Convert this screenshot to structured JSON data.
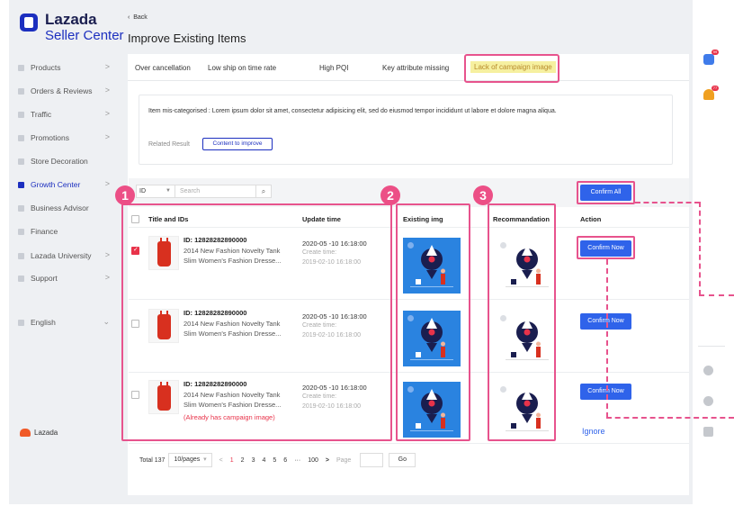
{
  "app": {
    "brand": "Lazada",
    "brand_sub": "Seller Center",
    "footer_brand": "Lazada"
  },
  "header": {
    "back_label": "Back",
    "title": "Improve Existing Items"
  },
  "sidebar": {
    "items": [
      {
        "label": "Products",
        "icon": "box-icon",
        "arrow": ">"
      },
      {
        "label": "Orders & Reviews",
        "icon": "orders-icon",
        "arrow": ">"
      },
      {
        "label": "Traffic",
        "icon": "traffic-icon",
        "arrow": ">"
      },
      {
        "label": "Promotions",
        "icon": "promotions-icon",
        "arrow": ">"
      },
      {
        "label": "Store Decoration",
        "icon": "store-icon",
        "arrow": ""
      },
      {
        "label": "Growth Center",
        "icon": "growth-icon",
        "arrow": ">"
      },
      {
        "label": "Business Advisor",
        "icon": "advisor-icon",
        "arrow": ""
      },
      {
        "label": "Finance",
        "icon": "finance-icon",
        "arrow": ""
      },
      {
        "label": "Lazada University",
        "icon": "university-icon",
        "arrow": ">"
      },
      {
        "label": "Support",
        "icon": "support-icon",
        "arrow": ">"
      },
      {
        "label": "English",
        "icon": "language-icon",
        "arrow": "⌄"
      }
    ]
  },
  "tabs": [
    {
      "label": "Over cancellation"
    },
    {
      "label": "Low ship on time rate"
    },
    {
      "label": "High PQI"
    },
    {
      "label": "Key attribute missing"
    },
    {
      "label": "Lack of campaign image"
    }
  ],
  "info": {
    "text": "Item mis-categorised : Lorem ipsum dolor sit amet, consectetur adipisicing elit, sed do eiusmod tempor incididunt ut labore et dolore magna aliqua.",
    "related_label": "Related Result",
    "related_button": "Content to improve"
  },
  "filter": {
    "select_value": "ID",
    "search_placeholder": "Search",
    "confirm_all": "Confirm All"
  },
  "table": {
    "columns": {
      "title": "Title and IDs",
      "update": "Update time",
      "existing": "Existing img",
      "recommend": "Recommandation",
      "action": "Action"
    },
    "rows": [
      {
        "id": "ID: 12828282890000",
        "name": "2014 New Fashion Novelty Tank Slim Women's Fashion Dresse...",
        "update": "2020-05 -10  16:18:00",
        "create_label": "Create time:",
        "create": "2019-02-10  16:18:00",
        "note": "",
        "checked": true,
        "action": "Confirm Now",
        "ignore": ""
      },
      {
        "id": "ID: 12828282890000",
        "name": "2014 New Fashion Novelty Tank Slim Women's Fashion Dresse...",
        "update": "2020-05 -10  16:18:00",
        "create_label": "Create time:",
        "create": "2019-02-10  16:18:00",
        "note": "",
        "checked": false,
        "action": "Confirm Now",
        "ignore": ""
      },
      {
        "id": "ID: 12828282890000",
        "name": "2014 New Fashion Novelty Tank Slim Women's Fashion Dresse...",
        "update": "2020-05 -10  16:18:00",
        "create_label": "Create time:",
        "create": "2019-02-10  16:18:00",
        "note": "(Already has campaign image)",
        "checked": false,
        "action": "Confirm Now",
        "ignore": "Ignore"
      }
    ]
  },
  "annotations": {
    "n1": "1",
    "n2": "2",
    "n3": "3"
  },
  "pagination": {
    "total_label": "Total",
    "total": "137",
    "per_page": "10/pages",
    "prev": "<",
    "pages": [
      "1",
      "2",
      "3",
      "4",
      "5",
      "6",
      "···",
      "100"
    ],
    "next": ">",
    "page_label": "Page",
    "go": "Go"
  },
  "notifications": {
    "messages_badge": "99",
    "alerts_badge": "77"
  },
  "colors": {
    "brand": "#1c2fbf",
    "primary_button": "#2f63ea",
    "annotation": "#e7538d",
    "accent_red": "#e8334a"
  }
}
